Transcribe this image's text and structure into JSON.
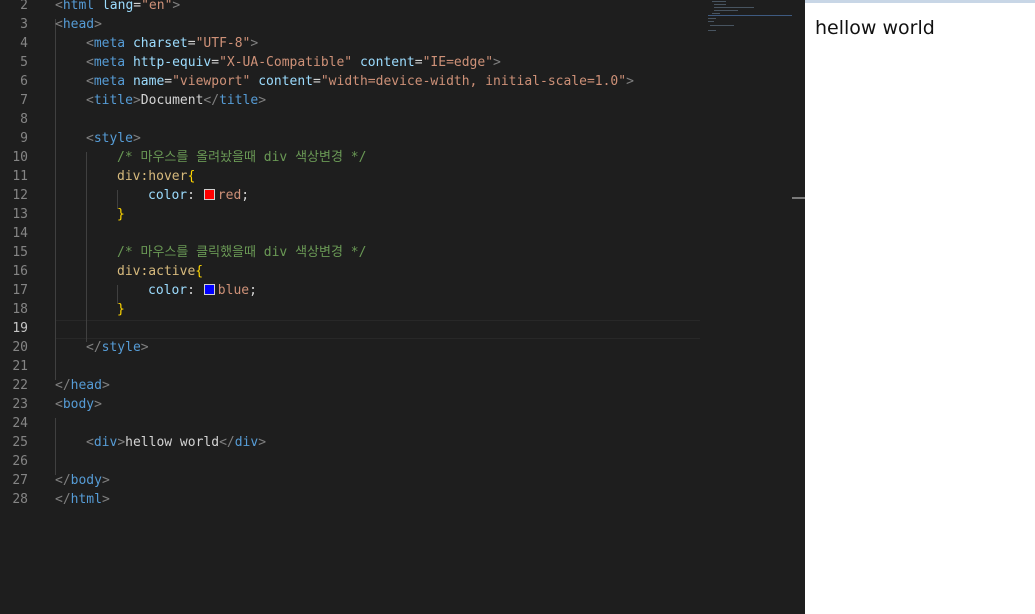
{
  "editor": {
    "line_numbers": [
      "2",
      "3",
      "4",
      "5",
      "6",
      "7",
      "8",
      "9",
      "10",
      "11",
      "12",
      "13",
      "14",
      "15",
      "16",
      "17",
      "18",
      "19",
      "20",
      "21",
      "22",
      "23",
      "24",
      "25",
      "26",
      "27",
      "28"
    ],
    "active_line": "19",
    "lines": {
      "l2": {
        "lt1": "<",
        "tag1": "html",
        "attr1": "lang",
        "eq1": "=",
        "val1": "\"en\"",
        "gt1": ">"
      },
      "l3": {
        "lt1": "<",
        "tag1": "head",
        "gt1": ">"
      },
      "l4": {
        "lt1": "<",
        "tag1": "meta",
        "attr1": "charset",
        "eq1": "=",
        "val1": "\"UTF-8\"",
        "gt1": ">"
      },
      "l5": {
        "lt1": "<",
        "tag1": "meta",
        "attr1": "http-equiv",
        "eq1": "=",
        "val1": "\"X-UA-Compatible\"",
        "attr2": "content",
        "eq2": "=",
        "val2": "\"IE=edge\"",
        "gt1": ">"
      },
      "l6": {
        "lt1": "<",
        "tag1": "meta",
        "attr1": "name",
        "eq1": "=",
        "val1": "\"viewport\"",
        "attr2": "content",
        "eq2": "=",
        "val2": "\"width=device-width, initial-scale=1.0\"",
        "gt1": ">"
      },
      "l7": {
        "lt1": "<",
        "tag1": "title",
        "gt1": ">",
        "text": "Document",
        "lt2": "</",
        "tag2": "title",
        "gt2": ">"
      },
      "l9": {
        "lt1": "<",
        "tag1": "style",
        "gt1": ">"
      },
      "l10": {
        "comment": "/* 마우스를 올려놨을때 div 색상변경 */"
      },
      "l11": {
        "selector": "div:hover",
        "brace": "{"
      },
      "l12": {
        "prop": "color",
        "colon": ":",
        "value": "red",
        "semi": ";",
        "swatch_color": "#ff0000"
      },
      "l13": {
        "brace": "}"
      },
      "l15": {
        "comment": "/* 마우스를 클릭했을때 div 색상변경 */"
      },
      "l16": {
        "selector": "div:active",
        "brace": "{"
      },
      "l17": {
        "prop": "color",
        "colon": ":",
        "value": "blue",
        "semi": ";",
        "swatch_color": "#0000ff"
      },
      "l18": {
        "brace": "}"
      },
      "l20": {
        "lt1": "</",
        "tag1": "style",
        "gt1": ">"
      },
      "l22": {
        "lt1": "</",
        "tag1": "head",
        "gt1": ">"
      },
      "l23": {
        "lt1": "<",
        "tag1": "body",
        "gt1": ">"
      },
      "l25": {
        "lt1": "<",
        "tag1": "div",
        "gt1": ">",
        "text": "hellow world",
        "lt2": "</",
        "tag2": "div",
        "gt2": ">"
      },
      "l27": {
        "lt1": "</",
        "tag1": "body",
        "gt1": ">"
      },
      "l28": {
        "lt1": "</",
        "tag1": "html",
        "gt1": ">"
      }
    }
  },
  "preview": {
    "text": "hellow world"
  },
  "colors": {
    "editor_bg": "#1e1e1e",
    "tag": "#569cd6",
    "attribute": "#9cdcfe",
    "string": "#ce9178",
    "comment": "#6a9955",
    "selector": "#d7ba7d",
    "brace": "#ffd700",
    "preview_bg": "#ffffff"
  }
}
